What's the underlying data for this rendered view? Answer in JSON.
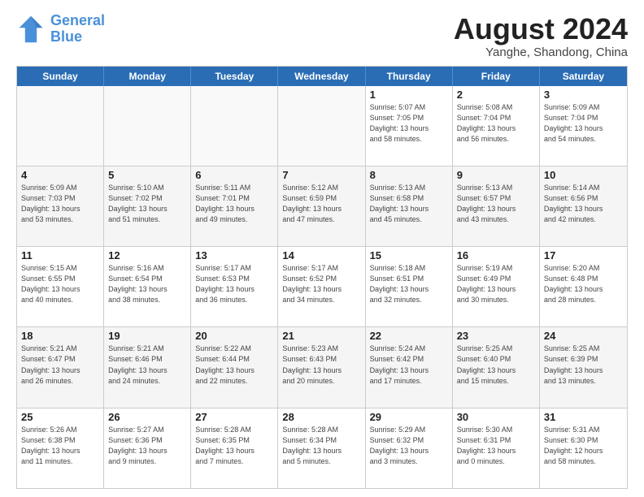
{
  "logo": {
    "line1": "General",
    "line2": "Blue"
  },
  "title": "August 2024",
  "subtitle": "Yanghe, Shandong, China",
  "header_days": [
    "Sunday",
    "Monday",
    "Tuesday",
    "Wednesday",
    "Thursday",
    "Friday",
    "Saturday"
  ],
  "weeks": [
    [
      {
        "day": "",
        "info": ""
      },
      {
        "day": "",
        "info": ""
      },
      {
        "day": "",
        "info": ""
      },
      {
        "day": "",
        "info": ""
      },
      {
        "day": "1",
        "info": "Sunrise: 5:07 AM\nSunset: 7:05 PM\nDaylight: 13 hours\nand 58 minutes."
      },
      {
        "day": "2",
        "info": "Sunrise: 5:08 AM\nSunset: 7:04 PM\nDaylight: 13 hours\nand 56 minutes."
      },
      {
        "day": "3",
        "info": "Sunrise: 5:09 AM\nSunset: 7:04 PM\nDaylight: 13 hours\nand 54 minutes."
      }
    ],
    [
      {
        "day": "4",
        "info": "Sunrise: 5:09 AM\nSunset: 7:03 PM\nDaylight: 13 hours\nand 53 minutes."
      },
      {
        "day": "5",
        "info": "Sunrise: 5:10 AM\nSunset: 7:02 PM\nDaylight: 13 hours\nand 51 minutes."
      },
      {
        "day": "6",
        "info": "Sunrise: 5:11 AM\nSunset: 7:01 PM\nDaylight: 13 hours\nand 49 minutes."
      },
      {
        "day": "7",
        "info": "Sunrise: 5:12 AM\nSunset: 6:59 PM\nDaylight: 13 hours\nand 47 minutes."
      },
      {
        "day": "8",
        "info": "Sunrise: 5:13 AM\nSunset: 6:58 PM\nDaylight: 13 hours\nand 45 minutes."
      },
      {
        "day": "9",
        "info": "Sunrise: 5:13 AM\nSunset: 6:57 PM\nDaylight: 13 hours\nand 43 minutes."
      },
      {
        "day": "10",
        "info": "Sunrise: 5:14 AM\nSunset: 6:56 PM\nDaylight: 13 hours\nand 42 minutes."
      }
    ],
    [
      {
        "day": "11",
        "info": "Sunrise: 5:15 AM\nSunset: 6:55 PM\nDaylight: 13 hours\nand 40 minutes."
      },
      {
        "day": "12",
        "info": "Sunrise: 5:16 AM\nSunset: 6:54 PM\nDaylight: 13 hours\nand 38 minutes."
      },
      {
        "day": "13",
        "info": "Sunrise: 5:17 AM\nSunset: 6:53 PM\nDaylight: 13 hours\nand 36 minutes."
      },
      {
        "day": "14",
        "info": "Sunrise: 5:17 AM\nSunset: 6:52 PM\nDaylight: 13 hours\nand 34 minutes."
      },
      {
        "day": "15",
        "info": "Sunrise: 5:18 AM\nSunset: 6:51 PM\nDaylight: 13 hours\nand 32 minutes."
      },
      {
        "day": "16",
        "info": "Sunrise: 5:19 AM\nSunset: 6:49 PM\nDaylight: 13 hours\nand 30 minutes."
      },
      {
        "day": "17",
        "info": "Sunrise: 5:20 AM\nSunset: 6:48 PM\nDaylight: 13 hours\nand 28 minutes."
      }
    ],
    [
      {
        "day": "18",
        "info": "Sunrise: 5:21 AM\nSunset: 6:47 PM\nDaylight: 13 hours\nand 26 minutes."
      },
      {
        "day": "19",
        "info": "Sunrise: 5:21 AM\nSunset: 6:46 PM\nDaylight: 13 hours\nand 24 minutes."
      },
      {
        "day": "20",
        "info": "Sunrise: 5:22 AM\nSunset: 6:44 PM\nDaylight: 13 hours\nand 22 minutes."
      },
      {
        "day": "21",
        "info": "Sunrise: 5:23 AM\nSunset: 6:43 PM\nDaylight: 13 hours\nand 20 minutes."
      },
      {
        "day": "22",
        "info": "Sunrise: 5:24 AM\nSunset: 6:42 PM\nDaylight: 13 hours\nand 17 minutes."
      },
      {
        "day": "23",
        "info": "Sunrise: 5:25 AM\nSunset: 6:40 PM\nDaylight: 13 hours\nand 15 minutes."
      },
      {
        "day": "24",
        "info": "Sunrise: 5:25 AM\nSunset: 6:39 PM\nDaylight: 13 hours\nand 13 minutes."
      }
    ],
    [
      {
        "day": "25",
        "info": "Sunrise: 5:26 AM\nSunset: 6:38 PM\nDaylight: 13 hours\nand 11 minutes."
      },
      {
        "day": "26",
        "info": "Sunrise: 5:27 AM\nSunset: 6:36 PM\nDaylight: 13 hours\nand 9 minutes."
      },
      {
        "day": "27",
        "info": "Sunrise: 5:28 AM\nSunset: 6:35 PM\nDaylight: 13 hours\nand 7 minutes."
      },
      {
        "day": "28",
        "info": "Sunrise: 5:28 AM\nSunset: 6:34 PM\nDaylight: 13 hours\nand 5 minutes."
      },
      {
        "day": "29",
        "info": "Sunrise: 5:29 AM\nSunset: 6:32 PM\nDaylight: 13 hours\nand 3 minutes."
      },
      {
        "day": "30",
        "info": "Sunrise: 5:30 AM\nSunset: 6:31 PM\nDaylight: 13 hours\nand 0 minutes."
      },
      {
        "day": "31",
        "info": "Sunrise: 5:31 AM\nSunset: 6:30 PM\nDaylight: 12 hours\nand 58 minutes."
      }
    ]
  ]
}
